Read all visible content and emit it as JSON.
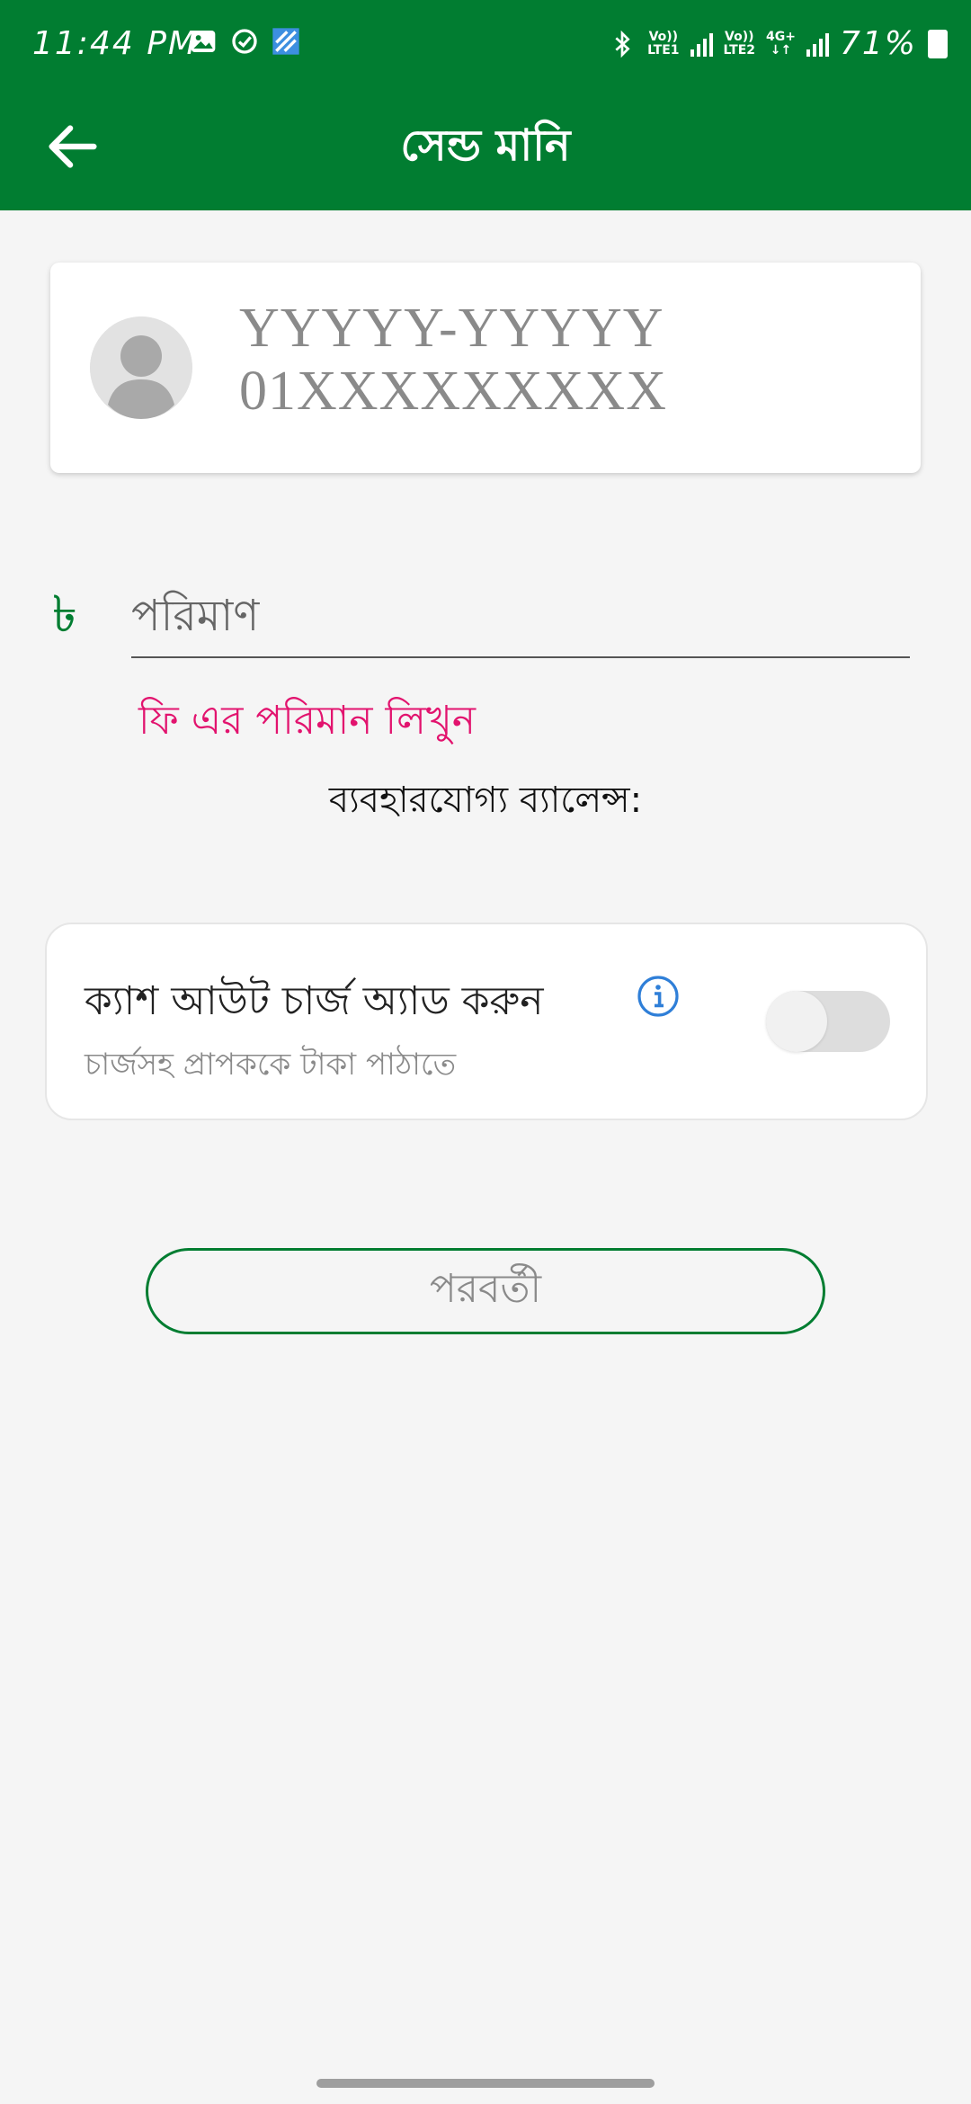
{
  "status_bar": {
    "time": "11:44 PM",
    "left_icons": [
      "gallery-icon",
      "check-circle-icon",
      "app-shortcut-icon"
    ],
    "bluetooth_icon": "bluetooth-icon",
    "sim1_label_top": "Vo))",
    "sim1_label_bottom": "LTE1",
    "sim2_label_top": "Vo))",
    "sim2_label_bottom": "LTE2",
    "data_label_top": "4G+",
    "data_label_bottom": "↓↑",
    "battery": "71%"
  },
  "app_bar": {
    "title": "সেন্ড মানি",
    "back_icon": "arrow-left-icon",
    "background": "#017d31"
  },
  "recipient": {
    "name": "YYYYY-YYYYY",
    "number": "01XXXXXXXXX",
    "avatar_icon": "person-icon"
  },
  "amount": {
    "currency_symbol": "৳",
    "placeholder": "পরিমাণ",
    "value": "",
    "error": "ফি এর পরিমান লিখুন",
    "error_color": "#e2136e",
    "balance_label": "ব্যবহারযোগ্য ব্যালেন্স:"
  },
  "cashout_charge": {
    "title": "ক্যাশ আউট চার্জ অ্যাড করুন",
    "subtitle": "চার্জসহ প্রাপককে টাকা পাঠাতে",
    "info_icon": "info-icon",
    "enabled": false
  },
  "next_button": {
    "label": "পরবর্তী",
    "border_color": "#017d31"
  }
}
